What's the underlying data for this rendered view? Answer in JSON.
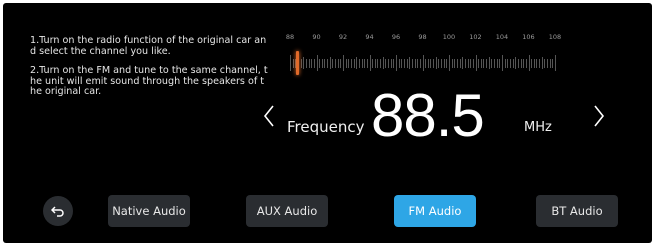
{
  "instructions": {
    "step1": "1.Turn on the radio function of the original car and select the channel you like.",
    "step2": "2.Turn on the FM and tune to the same channel, the unit will emit sound through the speakers of the original car."
  },
  "tuner": {
    "scale_labels": [
      "88",
      "90",
      "92",
      "94",
      "96",
      "98",
      "100",
      "102",
      "104",
      "106",
      "108"
    ],
    "current_frequency": 88.5,
    "cursor_color": "#e06a2a"
  },
  "frequency": {
    "label": "Frequency",
    "value": "88.5",
    "unit": "MHz"
  },
  "icons": {
    "prev": "chevron-left-icon",
    "next": "chevron-right-icon",
    "back": "return-arrow-icon"
  },
  "sources": {
    "native": "Native Audio",
    "aux": "AUX Audio",
    "fm": "FM Audio",
    "bt": "BT Audio",
    "active": "fm"
  },
  "colors": {
    "background": "#000000",
    "button": "#2a2d31",
    "active_button": "#2ea6e6"
  }
}
